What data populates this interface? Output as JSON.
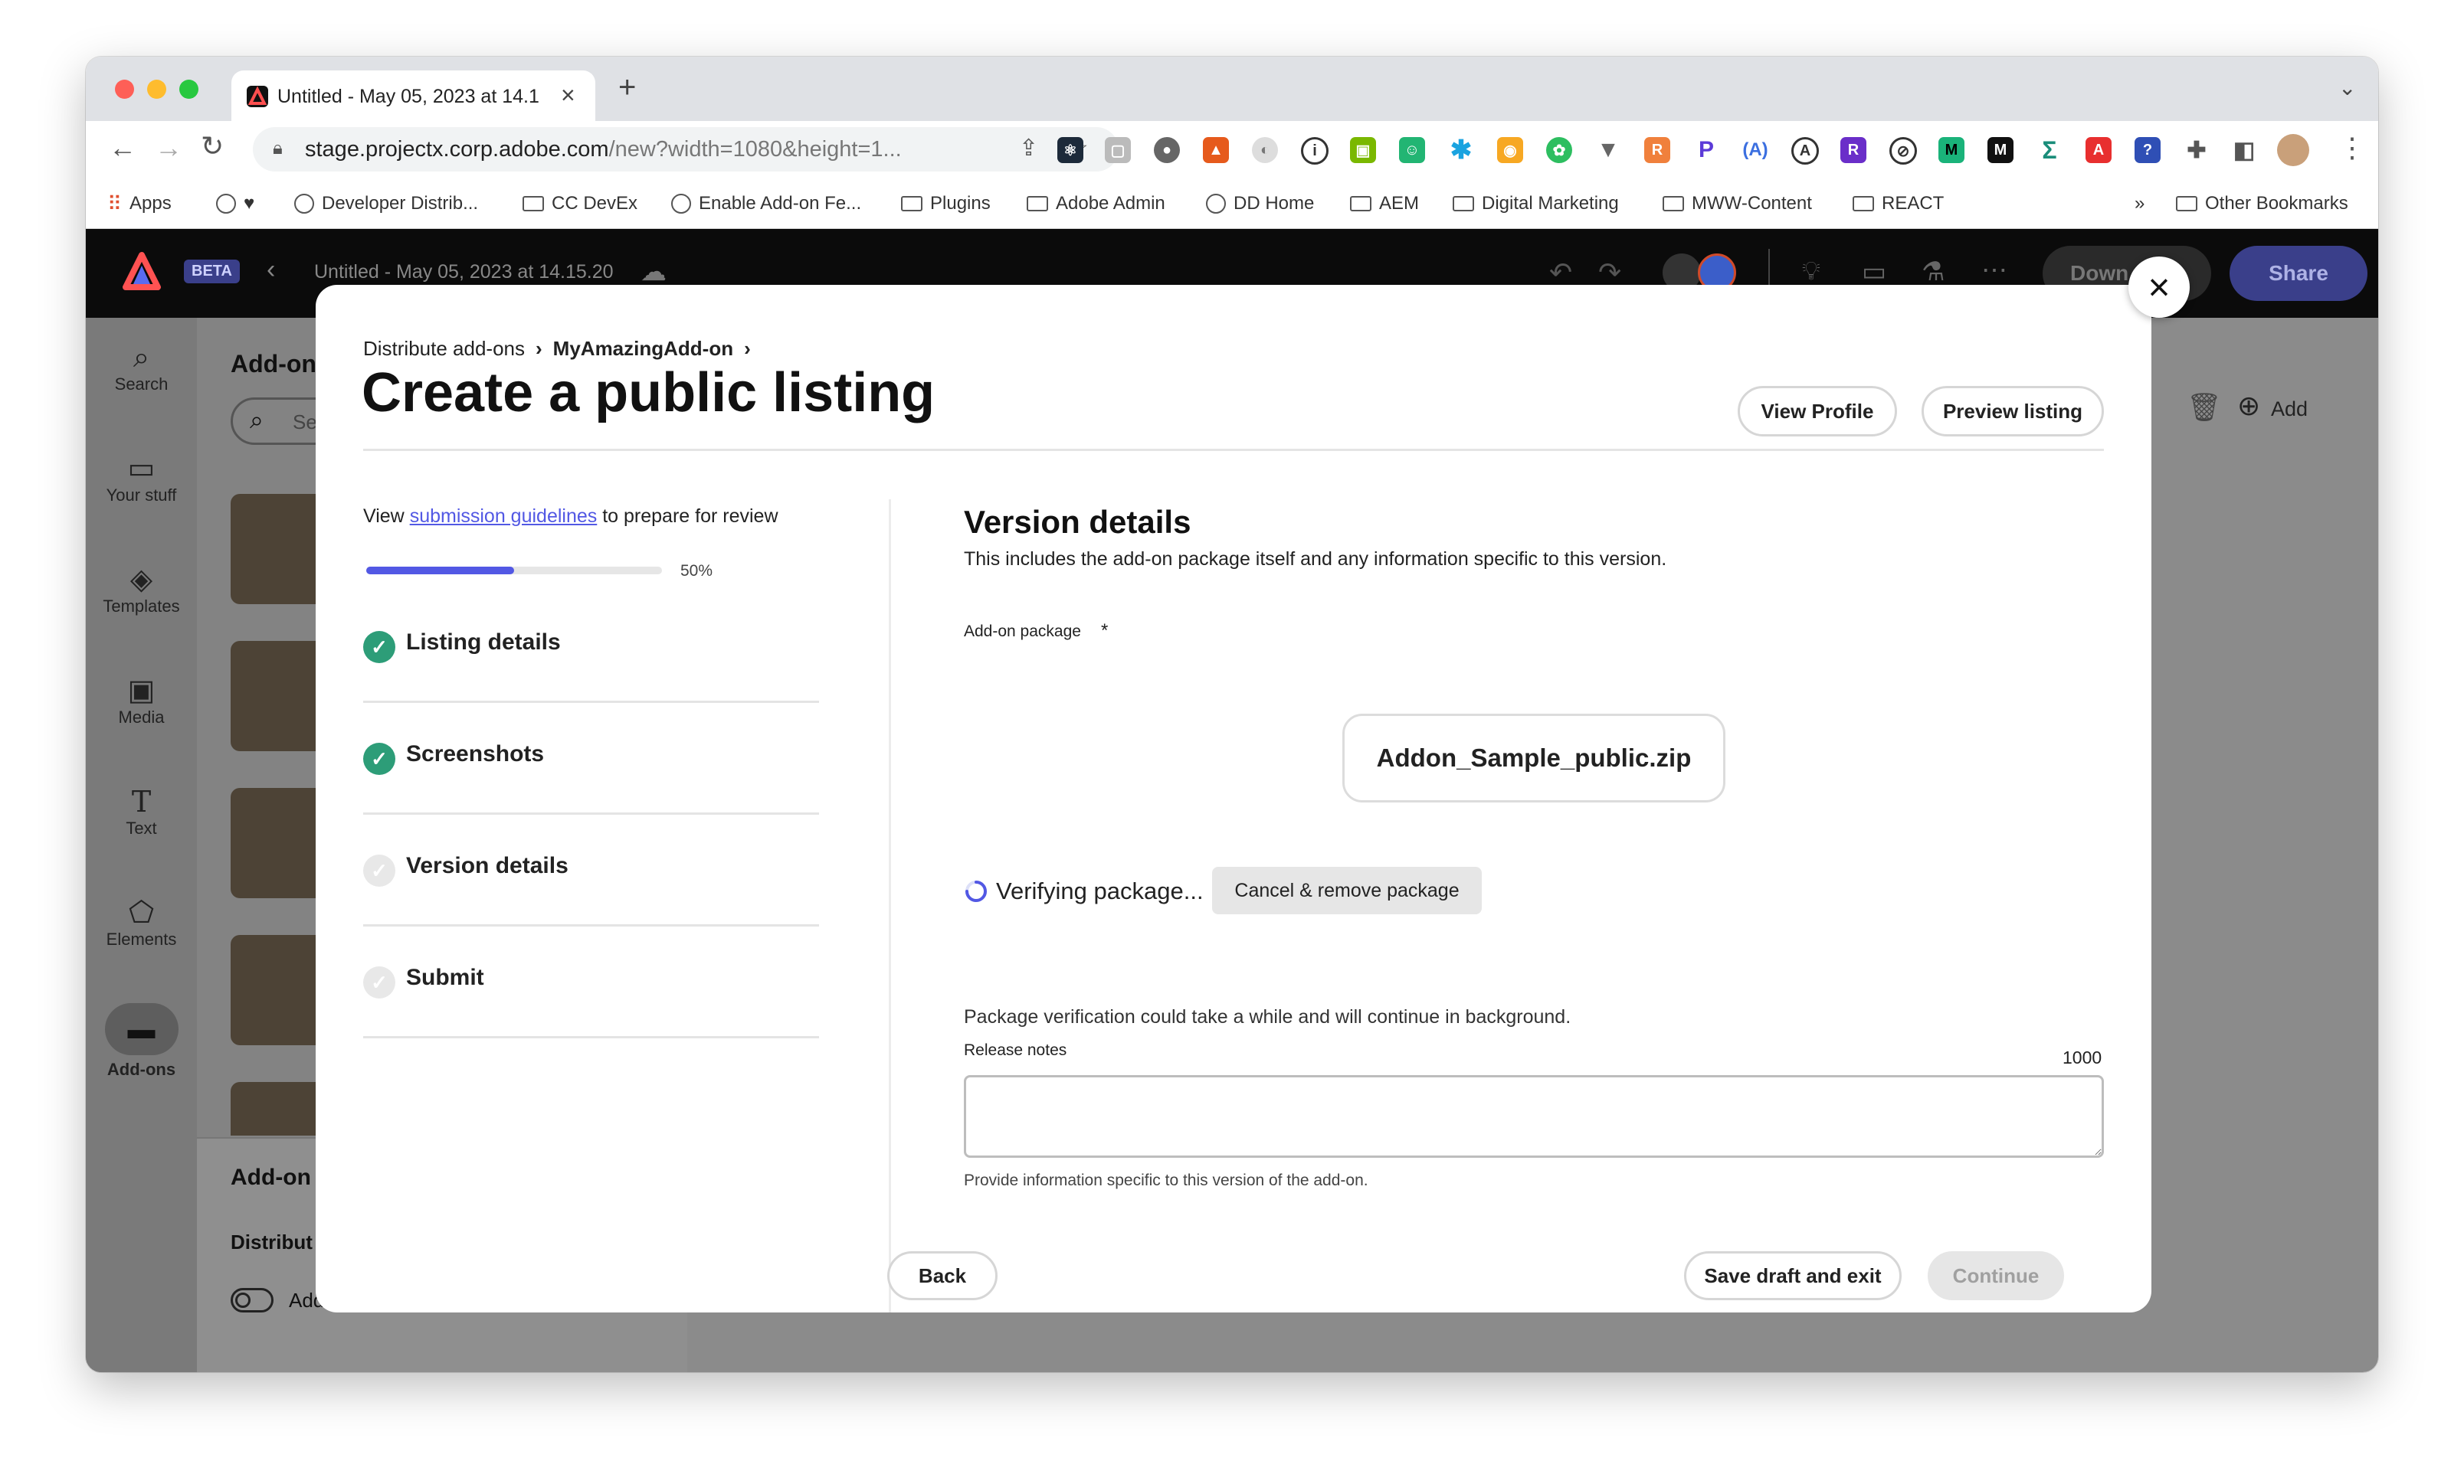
{
  "browser": {
    "tab_title": "Untitled - May 05, 2023 at 14.1",
    "url_domain": "stage.projectx.corp.adobe.com",
    "url_path": "/new?width=1080&height=1...",
    "bookmarks": [
      "Apps",
      "Developer Distrib...",
      "CC DevEx",
      "Enable Add-on Fe...",
      "Plugins",
      "Adobe Admin",
      "DD Home",
      "AEM",
      "Digital Marketing",
      "MWW-Content",
      "REACT"
    ],
    "overflow": "»",
    "other_bookmarks": "Other Bookmarks"
  },
  "app": {
    "beta": "BETA",
    "doc_title": "Untitled - May 05, 2023 at 14.15.20",
    "download_label": "Down",
    "share_label": "Share",
    "add_label": "Add",
    "rail": [
      "Search",
      "Your stuff",
      "Templates",
      "Media",
      "Text",
      "Elements",
      "Add-ons"
    ],
    "panel_title": "Add-on",
    "search_placeholder": "Se",
    "panel_section": "Add-on",
    "panel_distribute": "Distribut",
    "testing_label": "Add-on testing"
  },
  "modal": {
    "breadcrumb_root": "Distribute add-ons",
    "breadcrumb_current": "MyAmazingAdd-on",
    "title": "Create a public listing",
    "view_profile": "View Profile",
    "preview_listing": "Preview listing",
    "guide_prefix": "View ",
    "guide_link": "submission guidelines",
    "guide_suffix": " to prepare for review",
    "progress_text": "50%",
    "progress_value": 0.5,
    "steps": [
      {
        "label": "Listing details",
        "done": true
      },
      {
        "label": "Screenshots",
        "done": true
      },
      {
        "label": "Version details",
        "done": false
      },
      {
        "label": "Submit",
        "done": false
      }
    ],
    "section_title": "Version details",
    "section_desc": "This includes the add-on package itself and any information specific to this version.",
    "package_label": "Add-on package",
    "required_mark": "*",
    "package_file": "Addon_Sample_public.zip",
    "verifying": "Verifying package...",
    "cancel_remove": "Cancel & remove package",
    "verify_note": "Package verification could take a while and will continue in background.",
    "release_notes_label": "Release notes",
    "char_limit": "1000",
    "release_notes_value": "",
    "helper": "Provide information specific to this version of the add-on.",
    "back": "Back",
    "save_draft": "Save draft and exit",
    "continue": "Continue"
  },
  "colors": {
    "accent": "#5258e4",
    "success": "#2d9d78",
    "share": "#4046ca"
  }
}
